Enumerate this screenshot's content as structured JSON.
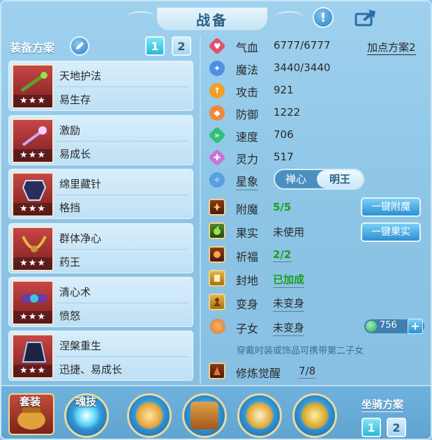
{
  "window": {
    "title": "战备"
  },
  "left": {
    "equip_label": "装备方案",
    "plan_buttons": [
      "1",
      "2"
    ],
    "skills": [
      {
        "name": "天地护法",
        "sub": "易生存",
        "stars": "★★★"
      },
      {
        "name": "激励",
        "sub": "易成长",
        "stars": "★★★"
      },
      {
        "name": "绵里藏针",
        "sub": "格挡",
        "stars": "★★★"
      },
      {
        "name": "群体净心",
        "sub": "药王",
        "stars": "★★★"
      },
      {
        "name": "清心术",
        "sub": "愤怒",
        "stars": "★★★"
      },
      {
        "name": "涅槃重生",
        "sub": "迅捷、易成长",
        "stars": "★★★"
      }
    ]
  },
  "stats": {
    "plan_link": "加点方案2",
    "items": [
      {
        "label": "气血",
        "value": "6777/6777",
        "color": "#e0506a",
        "icon": "heart-icon"
      },
      {
        "label": "魔法",
        "value": "3440/3440",
        "color": "#4f8fe6",
        "icon": "magic-icon"
      },
      {
        "label": "攻击",
        "value": "921",
        "color": "#f0a028",
        "icon": "attack-icon"
      },
      {
        "label": "防御",
        "value": "1222",
        "color": "#f08a3a",
        "icon": "defense-icon"
      },
      {
        "label": "速度",
        "value": "706",
        "color": "#2fc07a",
        "icon": "speed-icon"
      },
      {
        "label": "灵力",
        "value": "517",
        "color": "#c774d9",
        "icon": "spirit-icon"
      }
    ],
    "star_label": "星象",
    "star_options": [
      "禅心",
      "明王"
    ]
  },
  "rows": {
    "enchant": {
      "label": "附魔",
      "value": "5/5",
      "button": "一键附魔"
    },
    "fruit": {
      "label": "果实",
      "value": "未使用",
      "button": "一键果实"
    },
    "bless": {
      "label": "祈福",
      "value": "2/2"
    },
    "seal": {
      "label": "封地",
      "value": "已加成"
    },
    "transform": {
      "label": "变身",
      "value": "未变身"
    },
    "child": {
      "label": "子女",
      "value": "未变身",
      "currency": "756"
    },
    "hint": "穿戴时装或饰品可携带第二子女",
    "awaken": {
      "label": "修炼觉醒",
      "value": "7/8"
    }
  },
  "bottom": {
    "tab_suit": "套装",
    "tab_soul": "魂技",
    "mount_label": "坐骑方案",
    "mount_buttons": [
      "1",
      "2"
    ]
  }
}
